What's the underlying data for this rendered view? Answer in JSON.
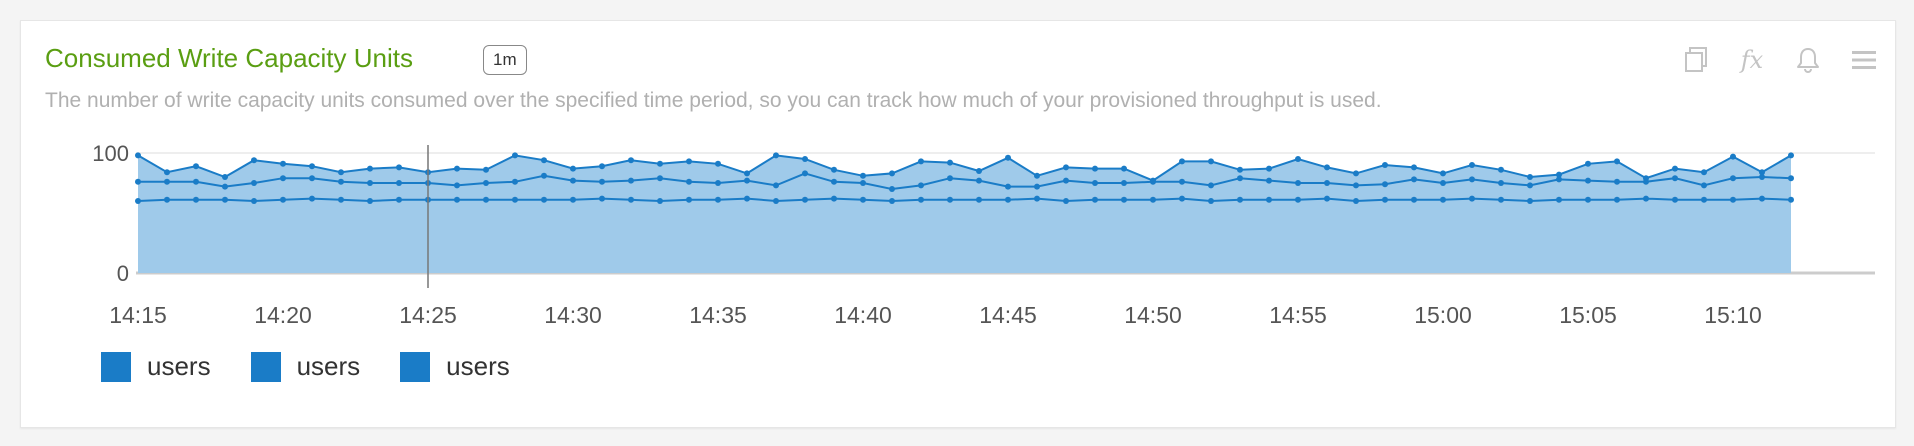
{
  "widget": {
    "title": "Consumed Write Capacity Units",
    "interval_badge": "1m",
    "description": "The number of write capacity units consumed over the specified time period, so you can track how much of your provisioned throughput is used."
  },
  "toolbar": {
    "icons": [
      "copy-icon",
      "fx-icon",
      "bell-icon",
      "menu-icon"
    ],
    "fx_label": "fx"
  },
  "colors": {
    "title": "#5a9e12",
    "area_fill": "#9fcaea",
    "line": "#1a7cc7",
    "legend_swatch": "#1a7cc7"
  },
  "chart_data": {
    "type": "area",
    "title": "",
    "xlabel": "",
    "ylabel": "",
    "ylim": [
      0,
      100
    ],
    "yticks": [
      0,
      100
    ],
    "xticks": [
      "14:15",
      "14:20",
      "14:25",
      "14:30",
      "14:35",
      "14:40",
      "14:45",
      "14:50",
      "14:55",
      "15:00",
      "15:05",
      "15:10"
    ],
    "x_start": "14:15",
    "x_end": "15:12",
    "x_step_minutes": 1,
    "stacked": true,
    "grid": "horizontal",
    "legend_position": "bottom-left",
    "cursor_time": "14:25",
    "x": [
      "14:15",
      "14:16",
      "14:17",
      "14:18",
      "14:19",
      "14:20",
      "14:21",
      "14:22",
      "14:23",
      "14:24",
      "14:25",
      "14:26",
      "14:27",
      "14:28",
      "14:29",
      "14:30",
      "14:31",
      "14:32",
      "14:33",
      "14:34",
      "14:35",
      "14:36",
      "14:37",
      "14:38",
      "14:39",
      "14:40",
      "14:41",
      "14:42",
      "14:43",
      "14:44",
      "14:45",
      "14:46",
      "14:47",
      "14:48",
      "14:49",
      "14:50",
      "14:51",
      "14:52",
      "14:53",
      "14:54",
      "14:55",
      "14:56",
      "14:57",
      "14:58",
      "14:59",
      "15:00",
      "15:01",
      "15:02",
      "15:03",
      "15:04",
      "15:05",
      "15:06",
      "15:07",
      "15:08",
      "15:09",
      "15:10",
      "15:11",
      "15:12"
    ],
    "series": [
      {
        "name": "users",
        "values": [
          60,
          61,
          61,
          61,
          60,
          61,
          62,
          61,
          60,
          61,
          61,
          61,
          61,
          61,
          61,
          61,
          62,
          61,
          60,
          61,
          61,
          62,
          60,
          61,
          62,
          61,
          60,
          61,
          61,
          61,
          61,
          62,
          60,
          61,
          61,
          61,
          62,
          60,
          61,
          61,
          61,
          62,
          60,
          61,
          61,
          61,
          62,
          61,
          60,
          61,
          61,
          61,
          62,
          61,
          61,
          61,
          62,
          61
        ]
      },
      {
        "name": "users",
        "values": [
          16,
          15,
          15,
          11,
          15,
          18,
          17,
          15,
          15,
          14,
          14,
          12,
          14,
          15,
          20,
          16,
          14,
          16,
          19,
          15,
          14,
          15,
          13,
          22,
          14,
          14,
          10,
          12,
          18,
          16,
          11,
          10,
          17,
          14,
          14,
          15,
          14,
          13,
          18,
          16,
          14,
          13,
          13,
          13,
          17,
          14,
          16,
          14,
          13,
          17,
          16,
          15,
          14,
          18,
          12,
          18,
          18,
          18
        ]
      },
      {
        "name": "users",
        "values": [
          22,
          8,
          13,
          8,
          19,
          12,
          10,
          8,
          12,
          13,
          9,
          14,
          11,
          22,
          13,
          10,
          13,
          17,
          12,
          17,
          16,
          6,
          25,
          12,
          10,
          6,
          13,
          20,
          13,
          8,
          24,
          9,
          11,
          12,
          12,
          1,
          17,
          20,
          7,
          10,
          20,
          13,
          10,
          16,
          10,
          8,
          12,
          11,
          7,
          4,
          14,
          17,
          3,
          8,
          11,
          18,
          4,
          19
        ]
      }
    ]
  },
  "legend": {
    "items": [
      "users",
      "users",
      "users"
    ]
  }
}
